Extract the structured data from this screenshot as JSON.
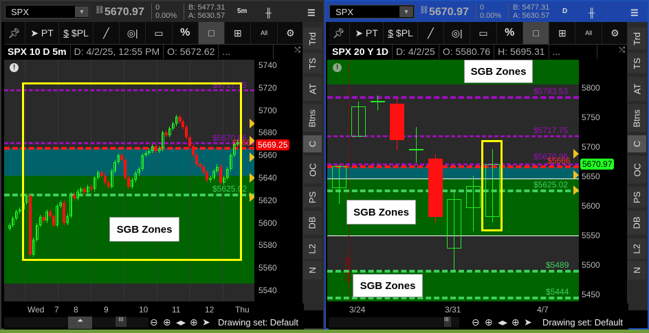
{
  "left": {
    "symbol": "SPX",
    "last": "5670.97",
    "change": "0",
    "change_pct": "0.00%",
    "bid": "B: 5477.31",
    "ask": "A: 5630.57",
    "timeframe": "5m",
    "toolbar": [
      "PT",
      "$PL",
      "%"
    ],
    "chart_header": {
      "title": "SPX 10 D 5m",
      "date": "D: 4/2/25, 12:55 PM",
      "open": "O: 5672.62",
      "more": "..."
    },
    "y_ticks": [
      "5740",
      "5720",
      "5700",
      "5680",
      "5660",
      "5640",
      "5620",
      "5600",
      "5580",
      "5560",
      "5540"
    ],
    "x_labels": [
      "Wed",
      "7",
      "8",
      "9",
      "10",
      "11",
      "12",
      "Thu"
    ],
    "price_tag": "5669.25",
    "level_labels": {
      "p1": "$5717.75",
      "p2": "$5670.86",
      "red": "$5666",
      "g1": "$5625.02"
    },
    "sgb_label": "SGB Zones",
    "closes": [
      5598,
      5604,
      5610,
      5612,
      5618,
      5624,
      5572,
      5585,
      5598,
      5605,
      5602,
      5610,
      5606,
      5598,
      5615,
      5618,
      5600,
      5606,
      5625,
      5622,
      5628,
      5630,
      5627,
      5632,
      5630,
      5640,
      5645,
      5642,
      5636,
      5632,
      5646,
      5654,
      5660,
      5656,
      5640,
      5632,
      5638,
      5644,
      5648,
      5660,
      5662,
      5664,
      5668,
      5664,
      5666,
      5680,
      5678,
      5684,
      5688,
      5694,
      5690,
      5685,
      5676,
      5668,
      5660,
      5652,
      5650,
      5645,
      5638,
      5640,
      5646,
      5650,
      5636,
      5640,
      5648,
      5660,
      5670,
      5672
    ]
  },
  "right": {
    "symbol": "SPX",
    "last": "5670.97",
    "change": "0",
    "change_pct": "0.00%",
    "bid": "B: 5477.31",
    "ask": "A: 5630.57",
    "timeframe": "D",
    "toolbar": [
      "PT",
      "$PL",
      "%"
    ],
    "chart_header": {
      "title": "SPX 20 Y 1D",
      "date": "D: 4/2/25",
      "open": "O: 5580.76",
      "high": "H: 5695.31",
      "more": "..."
    },
    "y_ticks": [
      "5800",
      "5750",
      "5700",
      "5650",
      "5600",
      "5550",
      "5500",
      "5450"
    ],
    "x_labels": [
      "3/24",
      "3/31",
      "4/7"
    ],
    "price_tag": "5670.97",
    "level_labels": {
      "p0": "$5783.53",
      "p1": "$5717.75",
      "p2": "$5670.86",
      "red": "$5666",
      "g1": "$5625.02",
      "g2": "$5489",
      "g3": "$5444"
    },
    "sgb_label": "SGB Zones",
    "date_marker": "3/21/25",
    "ohlc": [
      [
        5630,
        5670,
        5603,
        5668
      ],
      [
        5717,
        5777,
        5717,
        5769
      ],
      [
        5776,
        5787,
        5762,
        5778
      ],
      [
        5773,
        5783,
        5694,
        5712
      ],
      [
        5694,
        5734,
        5673,
        5696
      ],
      [
        5680,
        5687,
        5572,
        5581
      ],
      [
        5528,
        5623,
        5491,
        5612
      ],
      [
        5597,
        5651,
        5557,
        5634
      ],
      [
        5581,
        5697,
        5572,
        5671
      ]
    ]
  },
  "side_tabs": [
    "Trd",
    "TS",
    "AT",
    "Btns",
    "C",
    "OC",
    "PS",
    "DB",
    "L2",
    "N"
  ],
  "bottom": {
    "drawing_set": "Drawing set: Default"
  },
  "colors": {
    "up": "#22ee22",
    "down": "#ff1111",
    "purple": "#9a10b8",
    "red_line": "#ff1a1a",
    "green_line": "#3ecf5a",
    "teal": "#00636b",
    "zone_green": "#006400",
    "yellow": "#ffff00"
  }
}
